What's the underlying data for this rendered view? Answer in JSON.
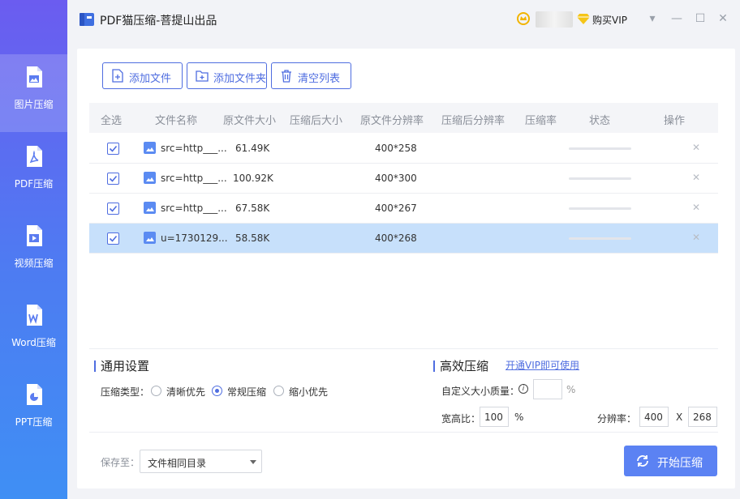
{
  "app": {
    "title": "PDF猫压缩-菩提山出品",
    "buy_vip": "购买VIP"
  },
  "window_controls": [
    "▾",
    "—",
    "☐",
    "✕"
  ],
  "sidebar": {
    "items": [
      {
        "label": "图片压缩",
        "icon": "image-file-icon",
        "active": true
      },
      {
        "label": "PDF压缩",
        "icon": "pdf-file-icon",
        "active": false
      },
      {
        "label": "视频压缩",
        "icon": "video-file-icon",
        "active": false
      },
      {
        "label": "Word压缩",
        "icon": "word-file-icon",
        "active": false
      },
      {
        "label": "PPT压缩",
        "icon": "ppt-file-icon",
        "active": false
      }
    ]
  },
  "toolbar": {
    "add_file": "添加文件",
    "add_folder": "添加文件夹",
    "clear_list": "清空列表"
  },
  "table": {
    "headers": {
      "select_all": "全选",
      "name": "文件名称",
      "original_size": "原文件大小",
      "compressed_size": "压缩后大小",
      "original_resolution": "原文件分辨率",
      "compressed_resolution": "压缩后分辨率",
      "ratio": "压缩率",
      "status": "状态",
      "action": "操作"
    },
    "rows": [
      {
        "name": "src=http___...",
        "size": "61.49K",
        "resolution": "400*258",
        "checked": true,
        "selected": false
      },
      {
        "name": "src=http___...",
        "size": "100.92K",
        "resolution": "400*300",
        "checked": true,
        "selected": false
      },
      {
        "name": "src=http___...",
        "size": "67.58K",
        "resolution": "400*267",
        "checked": true,
        "selected": false
      },
      {
        "name": "u=1730129...",
        "size": "58.58K",
        "resolution": "400*268",
        "checked": true,
        "selected": true
      }
    ]
  },
  "general_settings": {
    "title": "通用设置",
    "type_label": "压缩类型：",
    "options": [
      "清晰优先",
      "常规压缩",
      "缩小优先"
    ],
    "selected": "常规压缩"
  },
  "advanced": {
    "title": "高效压缩",
    "vip_link": "开通VIP即可使用",
    "quality_label": "自定义大小质量：",
    "quality_value": "",
    "percent": "%",
    "aspect_label": "宽高比：",
    "aspect_value": "100",
    "resolution_label": "分辨率：",
    "res_width": "400",
    "res_x": "X",
    "res_height": "268"
  },
  "footer": {
    "save_label": "保存至：",
    "save_option": "文件相同目录",
    "start_button": "开始压缩"
  },
  "colors": {
    "accent": "#4f6de0",
    "start": "#5b82f3",
    "selected_row": "#c7e0fb"
  }
}
